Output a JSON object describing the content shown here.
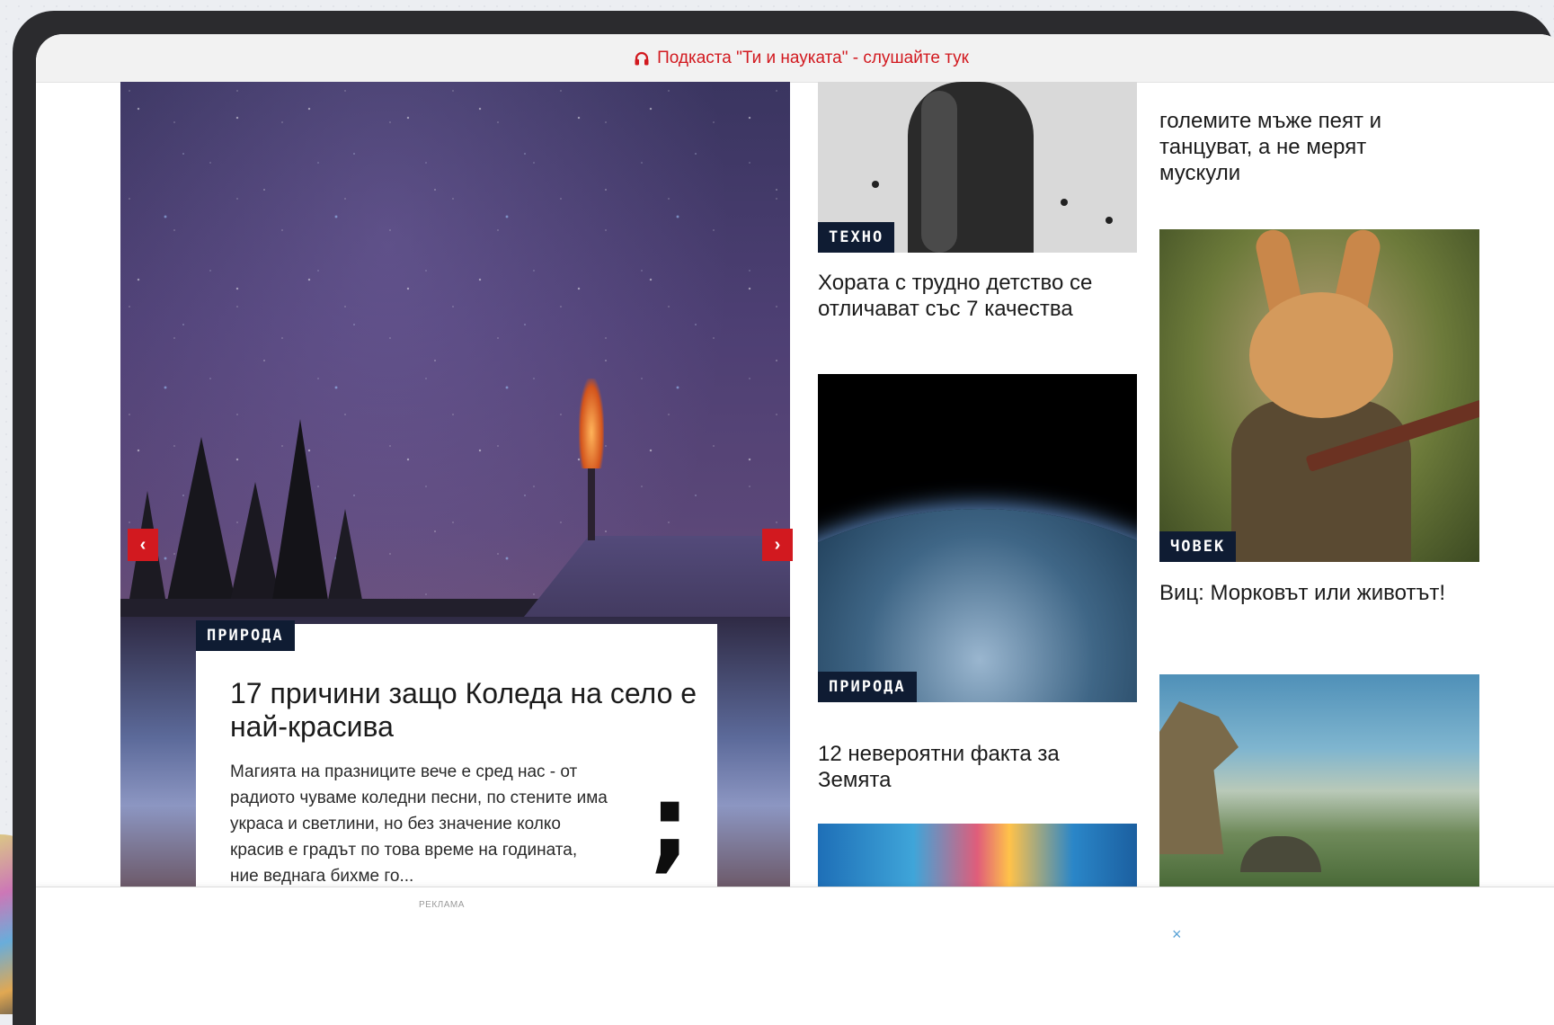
{
  "topbar": {
    "text": "Подкаста \"Ти и науката\" - слушайте тук",
    "icon": "headphones-icon",
    "color": "#d2191f"
  },
  "hero": {
    "category": "ПРИРОДА",
    "title": "17 причини защо Коледа на село е най-красива",
    "excerpt": "Магията на празниците вече е сред нас - от радиото чуваме коледни песни, по стените има украса и светлини, но без значение колко красив е градът по това време на годината, ние веднага бихме го...",
    "prev_label": "‹",
    "next_label": "›",
    "mark": ";"
  },
  "articles_middle": [
    {
      "category": "ТЕХНО",
      "title": "Хората с трудно детство се отличават със 7 качества"
    },
    {
      "category": "ПРИРОДА",
      "title": "12 невероятни факта за Земята"
    }
  ],
  "articles_right": [
    {
      "title_partial": "големите мъже пеят и танцуват, а не мерят мускули"
    },
    {
      "category": "ЧОВЕК",
      "title": "Виц: Морковът или животът!"
    }
  ],
  "ad": {
    "label": "РЕКЛАМА",
    "close": "×"
  },
  "colors": {
    "accent": "#d2191f",
    "badge": "#0f1c33",
    "close": "#5aa3d6"
  }
}
